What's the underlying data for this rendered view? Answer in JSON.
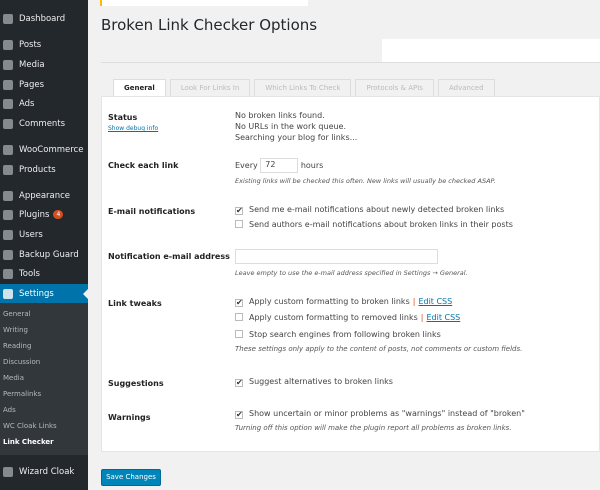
{
  "sidebar": {
    "items": [
      "Dashboard",
      "Posts",
      "Media",
      "Pages",
      "Ads",
      "Comments",
      "WooCommerce",
      "Products",
      "Appearance",
      "Plugins",
      "Users",
      "Backup Guard",
      "Tools",
      "Settings",
      "Wizard Cloak"
    ],
    "plugins_badge": "4",
    "submenu": [
      "General",
      "Writing",
      "Reading",
      "Discussion",
      "Media",
      "Permalinks",
      "Ads",
      "WC Cloak Links",
      "Link Checker"
    ]
  },
  "page": {
    "title": "Broken Link Checker Options"
  },
  "tabs": [
    "General",
    "Look For Links In",
    "Which Links To Check",
    "Protocols & APIs",
    "Advanced"
  ],
  "status": {
    "label": "Status",
    "debug_link": "Show debug info",
    "lines": [
      "No broken links found.",
      "No URLs in the work queue.",
      "Searching your blog for links..."
    ]
  },
  "check": {
    "label": "Check each link",
    "prefix": "Every",
    "value": "72",
    "suffix": "hours",
    "hint": "Existing links will be checked this often. New links will usually be checked ASAP."
  },
  "email": {
    "label": "E-mail notifications",
    "opt1": "Send me e-mail notifications about newly detected broken links",
    "opt2": "Send authors e-mail notifications about broken links in their posts"
  },
  "address": {
    "label": "Notification e-mail address",
    "value": "",
    "hint": "Leave empty to use the e-mail address specified in Settings → General."
  },
  "tweaks": {
    "label": "Link tweaks",
    "opt1": "Apply custom formatting to broken links",
    "opt2": "Apply custom formatting to removed links",
    "opt3": "Stop search engines from following broken links",
    "edit_css": "Edit CSS",
    "sep": "|",
    "hint": "These settings only apply to the content of posts, not comments or custom fields."
  },
  "suggestions": {
    "label": "Suggestions",
    "opt": "Suggest alternatives to broken links"
  },
  "warnings": {
    "label": "Warnings",
    "opt": "Show uncertain or minor problems as \"warnings\" instead of \"broken\"",
    "hint": "Turning off this option will make the plugin report all problems as broken links."
  },
  "save_label": "Save Changes",
  "check_mark": "✔"
}
